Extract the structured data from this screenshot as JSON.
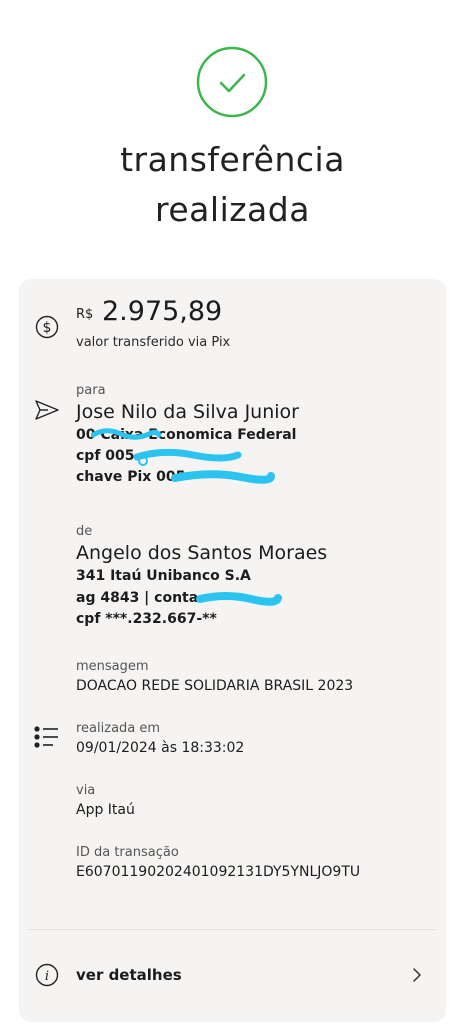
{
  "header": {
    "title_line1": "transferência",
    "title_line2": "realizada"
  },
  "amount": {
    "currency": "R$",
    "value": "2.975,89",
    "caption": "valor transferido via Pix"
  },
  "recipient": {
    "label": "para",
    "name": "Jose Nilo da Silva Junior",
    "bank_line": "00 Caixa Economica Federal",
    "cpf_line": "cpf 005.",
    "key_line": "chave Pix 005"
  },
  "sender": {
    "label": "de",
    "name": "Angelo dos Santos Moraes",
    "bank_line": "341 Itaú Unibanco S.A",
    "account_line": "ag 4843 | conta",
    "cpf_line": "cpf ***.232.667-**"
  },
  "message": {
    "label": "mensagem",
    "value": "DOACAO REDE SOLIDARIA BRASIL 2023"
  },
  "date": {
    "label": "realizada em",
    "value": "09/01/2024 às 18:33:02"
  },
  "via": {
    "label": "via",
    "value": "App Itaú"
  },
  "transaction": {
    "label": "ID da transação",
    "value": "E60701190202401092131DY5YNLJO9TU"
  },
  "details": {
    "label": "ver detalhes"
  },
  "colors": {
    "success_green": "#3cb64a",
    "redaction_blue": "#2bc3f0"
  }
}
